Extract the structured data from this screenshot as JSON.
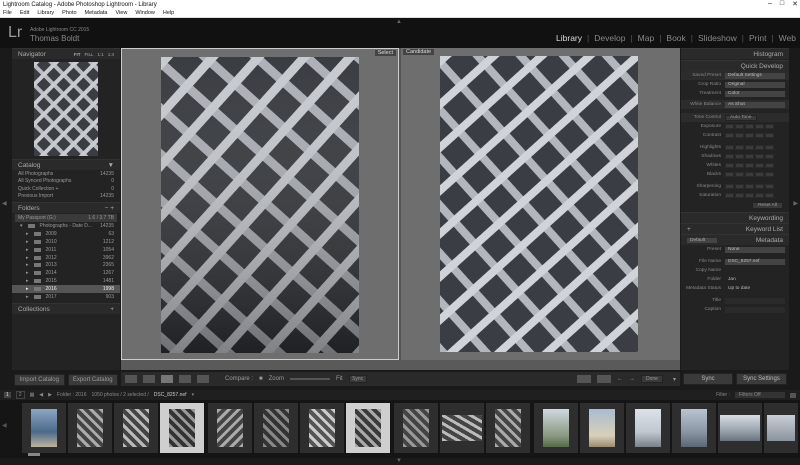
{
  "window": {
    "title": "Lightroom Catalog - Adobe Photoshop Lightroom - Library"
  },
  "menu": [
    "File",
    "Edit",
    "Library",
    "Photo",
    "Metadata",
    "View",
    "Window",
    "Help"
  ],
  "identity": {
    "logo": "Lr",
    "product": "Adobe Lightroom CC 2015",
    "user": "Thomas Boldt"
  },
  "modules": [
    "Library",
    "Develop",
    "Map",
    "Book",
    "Slideshow",
    "Print",
    "Web"
  ],
  "navigator": {
    "title": "Navigator",
    "zoom": [
      "FIT",
      "FILL",
      "1:1",
      "1:4"
    ]
  },
  "catalog": {
    "title": "Catalog",
    "items": [
      {
        "label": "All Photographs",
        "count": "14235"
      },
      {
        "label": "All Synced Photographs",
        "count": "0"
      },
      {
        "label": "Quick Collection +",
        "count": "0"
      },
      {
        "label": "Previous Import",
        "count": "14235"
      }
    ]
  },
  "folders": {
    "title": "Folders",
    "volume": {
      "label": "My Passport (G:)",
      "size": "1.6 / 3.7 TB"
    },
    "root": {
      "label": "Photographs - Date D...",
      "count": "14235"
    },
    "items": [
      {
        "label": "2009",
        "count": "63"
      },
      {
        "label": "2010",
        "count": "1212"
      },
      {
        "label": "2011",
        "count": "1054"
      },
      {
        "label": "2012",
        "count": "3962"
      },
      {
        "label": "2013",
        "count": "2365"
      },
      {
        "label": "2014",
        "count": "1267"
      },
      {
        "label": "2015",
        "count": "1481"
      },
      {
        "label": "2016",
        "count": "1998"
      },
      {
        "label": "2017",
        "count": "903"
      }
    ]
  },
  "collections": {
    "title": "Collections"
  },
  "left_buttons": {
    "import": "Import Catalog",
    "export": "Export Catalog"
  },
  "compare": {
    "select_label": "Select",
    "candidate_label": "Candidate",
    "compare_label": "Compare :",
    "zoom_label": "Zoom",
    "fit_label": "Fit",
    "sync_label": "Sync",
    "done_label": "Done"
  },
  "right": {
    "histogram": "Histogram",
    "quick_develop": "Quick Develop",
    "saved_preset_label": "Saved Preset",
    "saved_preset_value": "Default Settings",
    "crop_ratio_label": "Crop Ratio",
    "crop_ratio_value": "Original",
    "treatment_label": "Treatment",
    "treatment_value": "Color",
    "white_balance_label": "White Balance",
    "white_balance_value": "As Shot",
    "tone_control_label": "Tone Control",
    "auto_tone": "Auto Tone",
    "tone_rows": [
      "Exposure",
      "Contrast",
      "Highlights",
      "Shadows",
      "Whites",
      "Blacks",
      "Sharpening",
      "Saturation"
    ],
    "reset_all": "Reset All",
    "keywording": "Keywording",
    "keyword_list": "Keyword List",
    "metadata": "Metadata",
    "metadata_preset_select": "Default",
    "preset_label": "Preset",
    "preset_value": "None",
    "file_name_label": "File Name",
    "file_name_value": "DSC_8257.nef",
    "copy_name_label": "Copy Name",
    "folder_label": "Folder",
    "folder_value": "Jan",
    "metadata_status_label": "Metadata Status",
    "metadata_status_value": "Up to date",
    "title_label": "Title",
    "caption_label": "Caption",
    "sync_button": "Sync",
    "sync_settings_button": "Sync Settings"
  },
  "filmstrip": {
    "page1": "1",
    "page2": "2",
    "folder_info": "Folder : 2016",
    "selection_info": "1050 photos / 2 selected /",
    "filename": "DSC_8257.nef",
    "filter_label": "Filter :",
    "filter_value": "Filters Off"
  }
}
